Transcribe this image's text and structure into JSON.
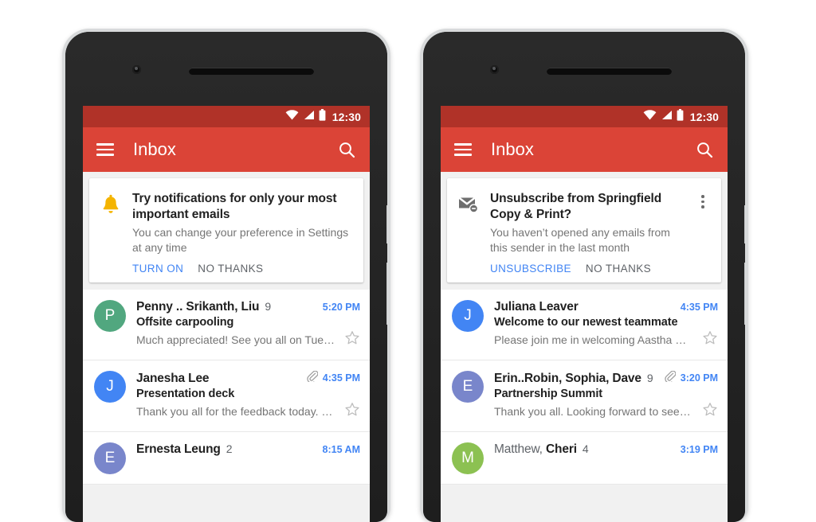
{
  "status_bar": {
    "time": "12:30",
    "icons": [
      "wifi-icon",
      "signal-icon",
      "battery-icon"
    ],
    "bg": "#b03228"
  },
  "app_bar": {
    "title": "Inbox",
    "menu_icon": "hamburger-menu-icon",
    "search_icon": "search-icon",
    "bg": "#db4437"
  },
  "colors": {
    "accent_blue": "#4285f4",
    "primary_red": "#db4437",
    "status_red": "#b03228",
    "bell_yellow": "#f4b400",
    "envelope_gray": "#6e6e6e"
  },
  "phones": [
    {
      "id": "phone-left",
      "promo": {
        "icon": "bell-icon",
        "title": "Try notifications for only your most important emails",
        "subtitle": "You can change your preference in Settings at any time",
        "primary_action": "TURN ON",
        "secondary_action": "NO THANKS",
        "has_overflow": false
      },
      "emails": [
        {
          "avatar_letter": "P",
          "avatar_color": "#51a77f",
          "sender": "Penny .. Srikanth, Liu",
          "sender_read": false,
          "count": "9",
          "has_attachment": false,
          "time": "5:20 PM",
          "subject": "Offsite carpooling",
          "snippet": "Much appreciated! See you all on Tue…",
          "starred": false
        },
        {
          "avatar_letter": "J",
          "avatar_color": "#4285f4",
          "sender": "Janesha Lee",
          "sender_read": false,
          "count": "",
          "has_attachment": true,
          "time": "4:35 PM",
          "subject": "Presentation deck",
          "snippet": "Thank you all for the feedback today. …",
          "starred": false
        },
        {
          "avatar_letter": "E",
          "avatar_color": "#7986cb",
          "sender": "Ernesta Leung",
          "sender_read": false,
          "count": "2",
          "has_attachment": false,
          "time": "8:15 AM",
          "subject": "",
          "snippet": "",
          "starred": false
        }
      ]
    },
    {
      "id": "phone-right",
      "promo": {
        "icon": "unsubscribe-envelope-icon",
        "title": "Unsubscribe from Springfield Copy & Print?",
        "subtitle": "You haven’t opened any emails from this sender in the last month",
        "primary_action": "UNSUBSCRIBE",
        "secondary_action": "NO THANKS",
        "has_overflow": true,
        "overflow_icon": "overflow-menu-icon"
      },
      "emails": [
        {
          "avatar_letter": "J",
          "avatar_color": "#4285f4",
          "sender": "Juliana Leaver",
          "sender_read": false,
          "count": "",
          "has_attachment": false,
          "time": "4:35 PM",
          "subject": "Welcome to our newest teammate",
          "snippet": "Please join me in welcoming Aastha …",
          "starred": false
        },
        {
          "avatar_letter": "E",
          "avatar_color": "#7986cb",
          "sender": "Erin..Robin, Sophia, Dave",
          "sender_read": false,
          "count": "9",
          "has_attachment": true,
          "time": "3:20 PM",
          "subject": "Partnership Summit",
          "snippet": "Thank you all. Looking forward to see…",
          "starred": false
        },
        {
          "avatar_letter": "M",
          "avatar_color": "#8cc152",
          "sender_html": "Matthew, <b>Cheri</b>",
          "sender": "Matthew, Cheri",
          "sender_read": true,
          "count": "4",
          "has_attachment": false,
          "time": "3:19 PM",
          "subject": "",
          "snippet": "",
          "starred": false
        }
      ]
    }
  ]
}
